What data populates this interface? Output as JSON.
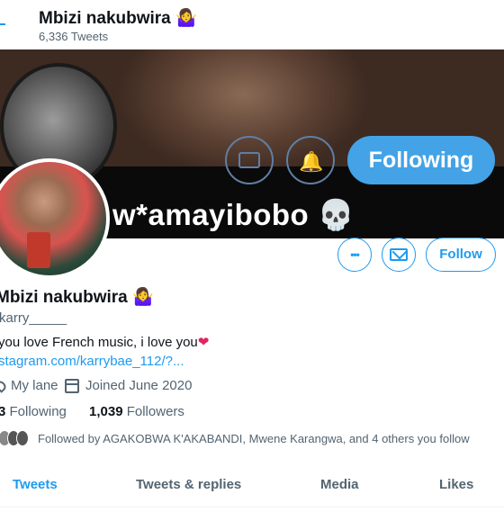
{
  "header": {
    "title": "Mbizi nakubwira 🤷‍♀️",
    "tweet_count": "6,336 Tweets"
  },
  "banner": {
    "overlay_button": "Following",
    "overlay_text": "w*amayibobo 💀"
  },
  "actions": {
    "more_label": "•••",
    "follow_label": "Follow"
  },
  "profile": {
    "name": "Mbizi nakubwira 🤷‍♀️",
    "handle": "karry_____",
    "bio_text": "you love French music, i love you",
    "bio_heart": "❤",
    "link": "stagram.com/karrybae_112/?...",
    "location": "My lane",
    "joined": "Joined June 2020",
    "following_count": "3",
    "following_label": "Following",
    "followers_count": "1,039",
    "followers_label": "Followers",
    "followed_by": "Followed by AGAKOBWA K'AKABANDI, Mwene Karangwa, and 4 others you follow"
  },
  "tabs": [
    "Tweets",
    "Tweets & replies",
    "Media",
    "Likes"
  ],
  "colors": {
    "accent": "#1d9bf0",
    "secondary_text": "#536471"
  },
  "icons": {
    "more": "more-icon",
    "mail": "mail-icon",
    "location": "location-icon",
    "calendar": "calendar-icon"
  }
}
